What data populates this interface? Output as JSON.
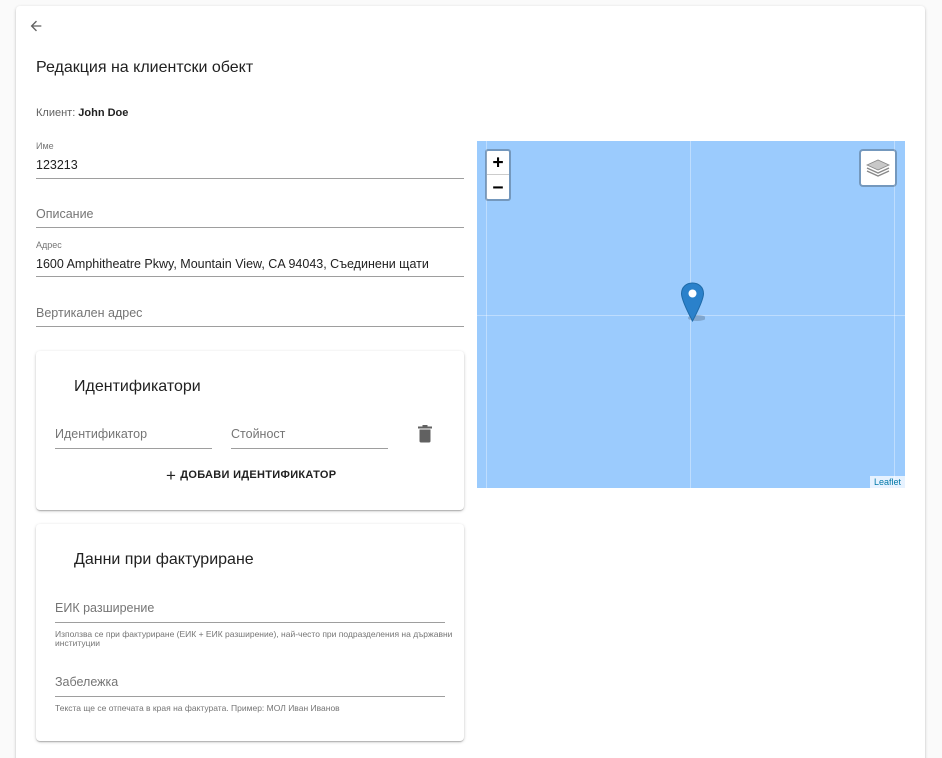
{
  "page": {
    "title": "Редакция на клиентски обект",
    "client_label": "Клиент:",
    "client_name": "John Doe"
  },
  "fields": {
    "name": {
      "label": "Име",
      "value": "123213"
    },
    "description": {
      "placeholder": "Описание"
    },
    "address": {
      "label": "Адрес",
      "value": "1600 Amphitheatre Pkwy, Mountain View, CA 94043, Съединени щати"
    },
    "vertical_address": {
      "placeholder": "Вертикален адрес"
    }
  },
  "identifiers": {
    "title": "Идентификатори",
    "identifier_placeholder": "Идентификатор",
    "value_placeholder": "Стойност",
    "add_label": "ДОБАВИ ИДЕНТИФИКАТОР"
  },
  "billing": {
    "title": "Данни при фактуриране",
    "eik_placeholder": "ЕИК разширение",
    "eik_helper": "Използва се при фактуриране (ЕИК + ЕИК разширение), най-често при подразделения на държавни институции",
    "note_placeholder": "Забележка",
    "note_helper": "Текста ще се отпечата в края на фактурата. Пример: МОЛ Иван Иванов"
  },
  "map": {
    "zoom_in": "+",
    "zoom_out": "−",
    "attribution": "Leaflet",
    "water_color": "#9bcbfd",
    "marker_color": "#2a81cb"
  },
  "icons": {
    "back": "arrow-left",
    "delete": "trash-can",
    "add": "plus",
    "layers": "layers",
    "marker": "map-pin"
  }
}
